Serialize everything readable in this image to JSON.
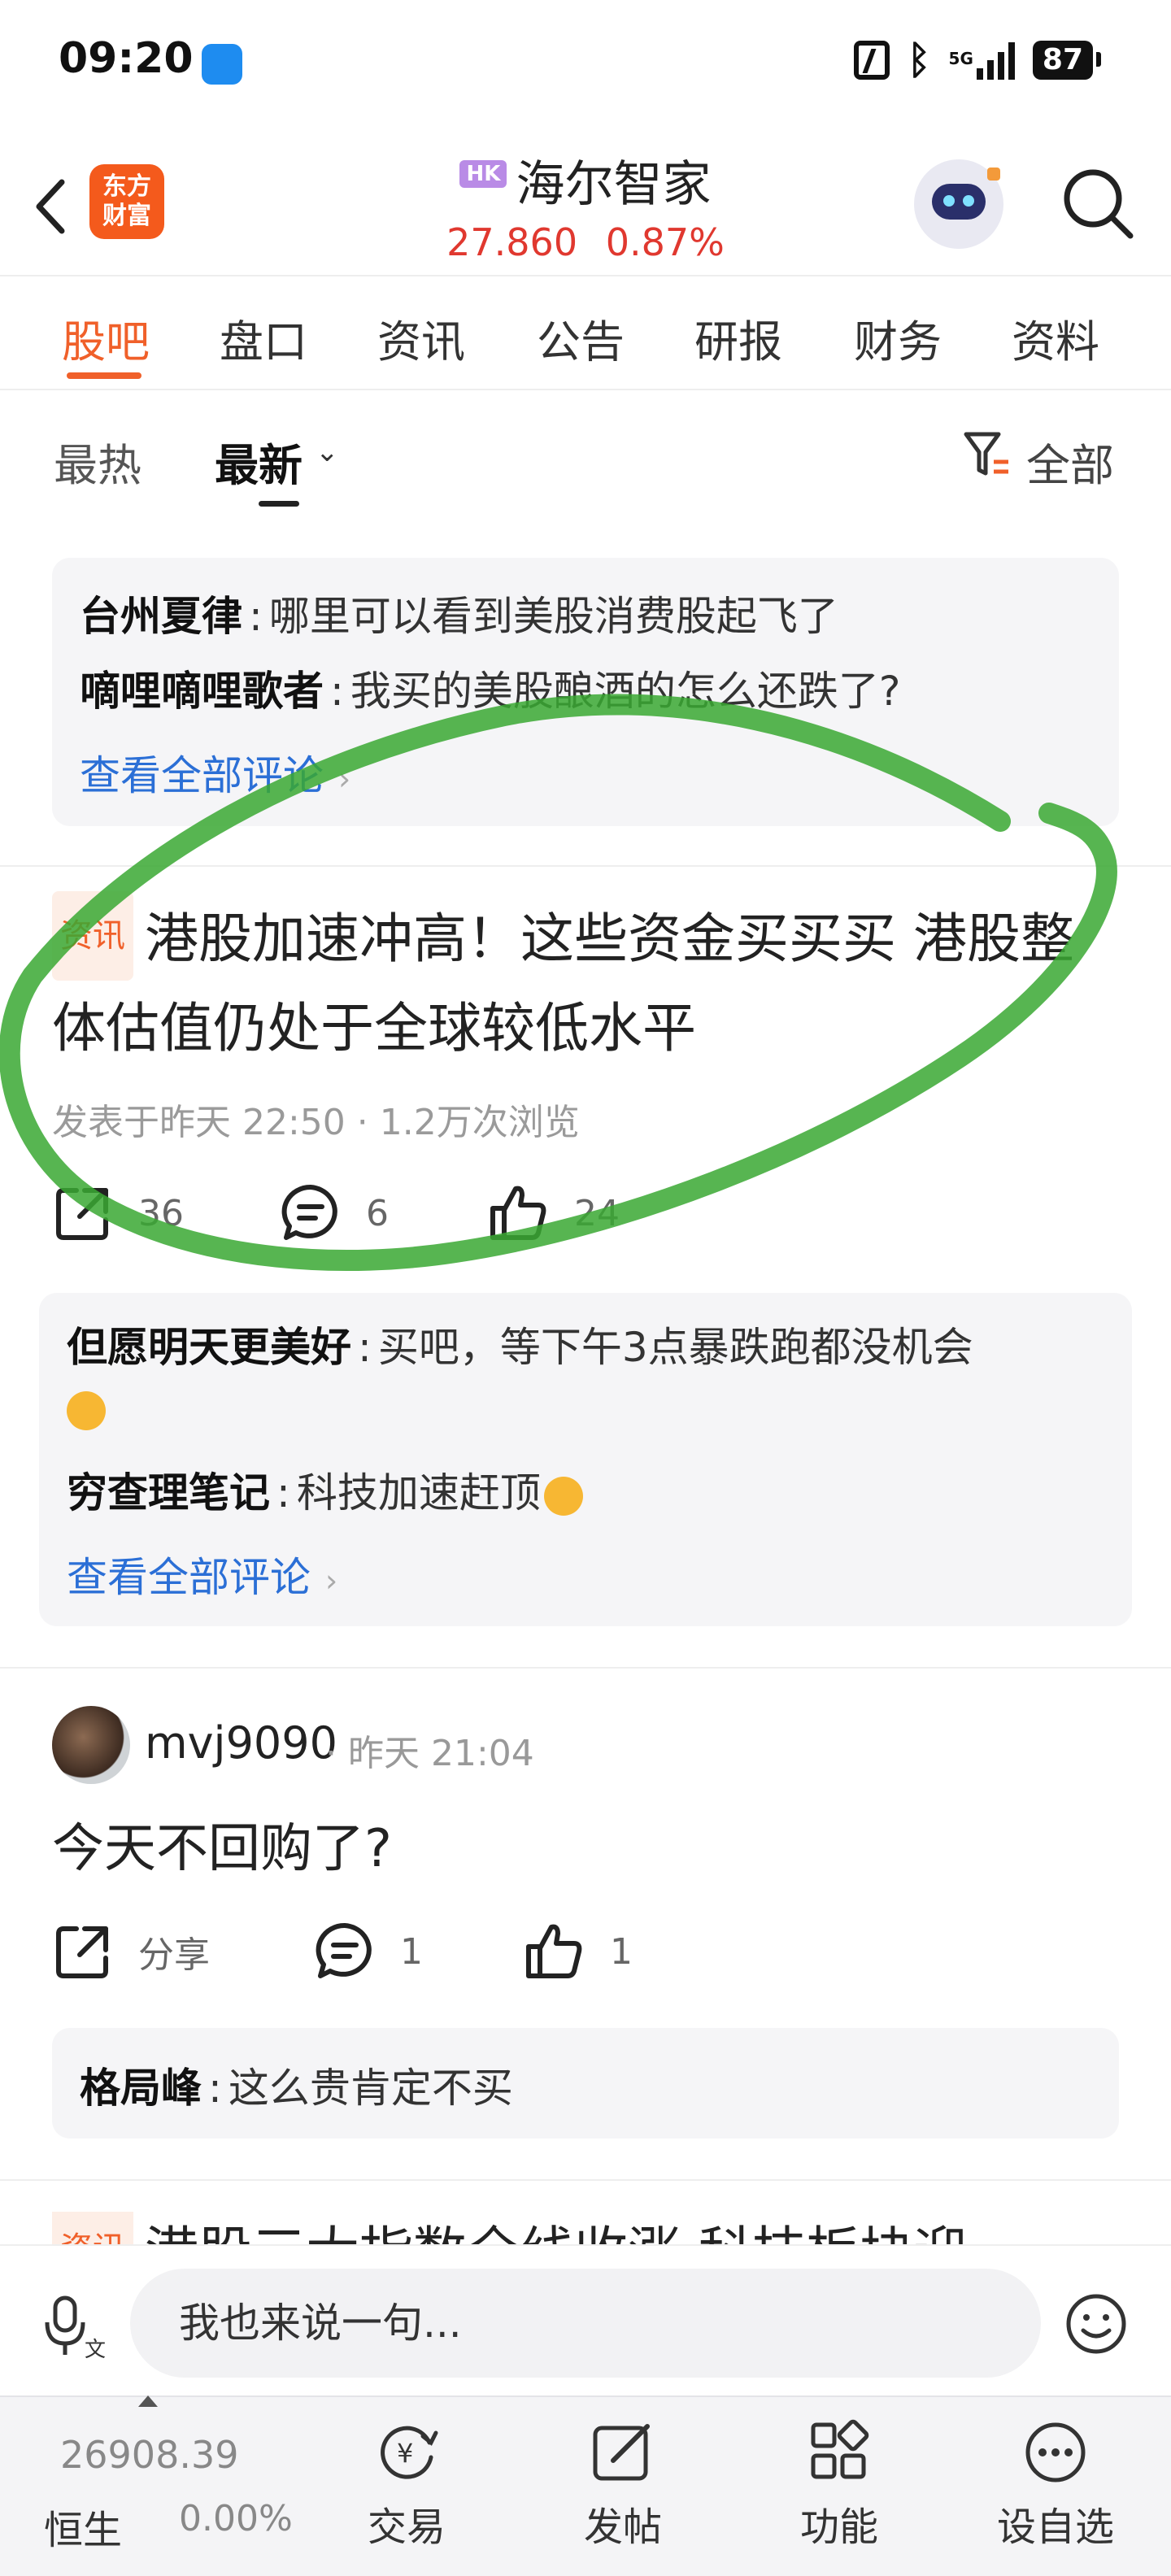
{
  "status_bar": {
    "time": "09:20",
    "network": "5G",
    "battery": "87"
  },
  "header": {
    "hk_tag": "HK",
    "stock_name": "海尔智家",
    "price": "27.860",
    "change_pct": "0.87%",
    "logo_text_line1": "东方",
    "logo_text_line2": "财富"
  },
  "tabs": [
    {
      "label": "股吧",
      "active": true
    },
    {
      "label": "盘口"
    },
    {
      "label": "资讯"
    },
    {
      "label": "公告"
    },
    {
      "label": "研报"
    },
    {
      "label": "财务"
    },
    {
      "label": "资料"
    }
  ],
  "sort": {
    "hot": "最热",
    "latest": "最新",
    "filter": "全部"
  },
  "comments_top": {
    "items": [
      {
        "user": "台州夏律",
        "text": "哪里可以看到美股消费股起飞了"
      },
      {
        "user": "嘀哩嘀哩歌者",
        "text": "我买的美股酿酒的怎么还跌了?"
      }
    ],
    "view_all": "查看全部评论"
  },
  "post1": {
    "tag": "资讯",
    "title": "港股加速冲高！这些资金买买买 港股整体估值仍处于全球较低水平",
    "meta": "发表于昨天 22:50 · 1.2万次浏览",
    "shares": "36",
    "comments": "6",
    "likes": "24",
    "replies": [
      {
        "user": "但愿明天更美好",
        "text": "买吧，等下午3点暴跌跑都没机会"
      },
      {
        "user": "穷查理笔记",
        "text": "科技加速赶顶"
      }
    ],
    "view_all": "查看全部评论"
  },
  "post2": {
    "user": "mvj9090",
    "time": "· 昨天 21:04",
    "text": "今天不回购了?",
    "share_label": "分享",
    "comments": "1",
    "likes": "1",
    "replies": [
      {
        "user": "格局峰",
        "text": "这么贵肯定不买"
      }
    ]
  },
  "post3_peek": {
    "tag": "资讯",
    "title": "港股三大指数全线收涨 科技板块迎"
  },
  "input": {
    "placeholder": "我也来说一句..."
  },
  "bottom_bar": {
    "index_value": "26908.39",
    "index_name": "恒生",
    "index_change": "0.00%",
    "nav": [
      {
        "label": "交易",
        "icon": "yen-cycle-icon"
      },
      {
        "label": "发帖",
        "icon": "edit-icon"
      },
      {
        "label": "功能",
        "icon": "grid-icon"
      },
      {
        "label": "设自选",
        "icon": "more-icon"
      }
    ]
  },
  "colors": {
    "accent": "#f0602a",
    "price_up": "#e0382f",
    "link": "#2b6fd6",
    "highlight": "#3aa832"
  }
}
